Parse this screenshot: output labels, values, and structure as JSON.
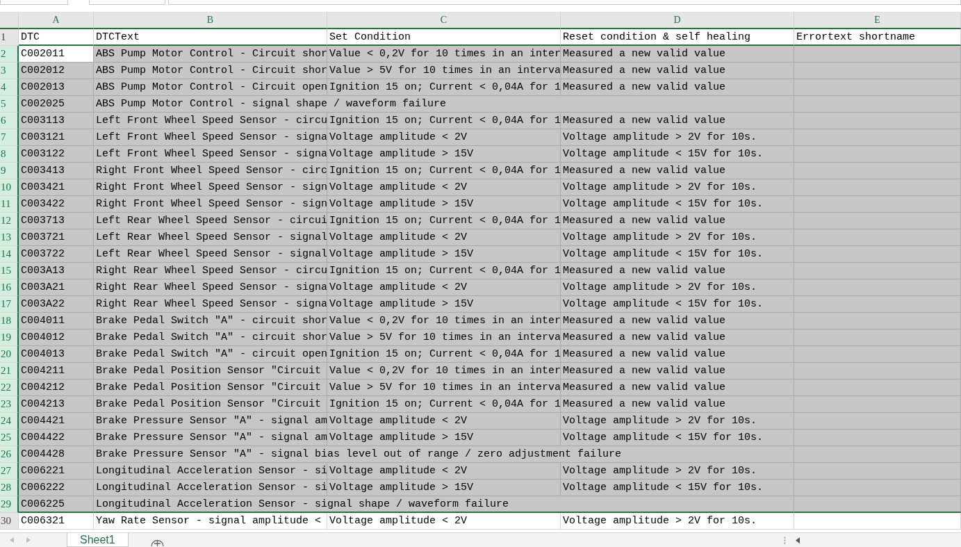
{
  "columns": [
    {
      "label": "A"
    },
    {
      "label": "B"
    },
    {
      "label": "C"
    },
    {
      "label": "D"
    },
    {
      "label": "E"
    }
  ],
  "rows": [
    {
      "number": "1",
      "selected": false,
      "cells": [
        "DTC",
        "DTCText",
        "Set Condition",
        "Reset condition & self healing",
        "Errortext shortname"
      ]
    },
    {
      "number": "2",
      "selected": true,
      "cells": [
        {
          "text": "C002011",
          "active": true
        },
        "ABS Pump Motor Control - Circuit shor",
        "Value < 0,2V for 10 times in an inter",
        "Measured a new valid value",
        null
      ]
    },
    {
      "number": "3",
      "selected": true,
      "cells": [
        "C002012",
        "ABS Pump Motor Control - Circuit shor",
        "Value > 5V for 10 times in an interva",
        "Measured a new valid value",
        null
      ]
    },
    {
      "number": "4",
      "selected": true,
      "cells": [
        "C002013",
        "ABS Pump Motor Control - Circuit open",
        "Ignition 15 on; Current < 0,04A for 1",
        "Measured a new valid value",
        null
      ]
    },
    {
      "number": "5",
      "selected": true,
      "cells": [
        "C002025",
        "ABS Pump Motor Control - signal shape / waveform failure",
        null,
        null,
        null
      ]
    },
    {
      "number": "6",
      "selected": true,
      "cells": [
        "C003113",
        "Left Front Wheel Speed Sensor - circu",
        "Ignition 15 on; Current < 0,04A for 1",
        "Measured a new valid value",
        null
      ]
    },
    {
      "number": "7",
      "selected": true,
      "cells": [
        "C003121",
        "Left Front Wheel Speed Sensor - signa",
        "Voltage amplitude < 2V",
        "Voltage amplitude > 2V for 10s.",
        null
      ]
    },
    {
      "number": "8",
      "selected": true,
      "cells": [
        "C003122",
        "Left Front Wheel Speed Sensor - signa",
        "Voltage amplitude > 15V",
        "Voltage amplitude < 15V for 10s.",
        null
      ]
    },
    {
      "number": "9",
      "selected": true,
      "cells": [
        "C003413",
        "Right Front Wheel Speed Sensor - circ",
        "Ignition 15 on; Current < 0,04A for 1",
        "Measured a new valid value",
        null
      ]
    },
    {
      "number": "10",
      "selected": true,
      "cells": [
        "C003421",
        "Right Front Wheel Speed Sensor - sign",
        "Voltage amplitude < 2V",
        "Voltage amplitude > 2V for 10s.",
        null
      ]
    },
    {
      "number": "11",
      "selected": true,
      "cells": [
        "C003422",
        "Right Front Wheel Speed Sensor - sign",
        "Voltage amplitude > 15V",
        "Voltage amplitude < 15V for 10s.",
        null
      ]
    },
    {
      "number": "12",
      "selected": true,
      "cells": [
        "C003713",
        "Left Rear Wheel Speed Sensor - circui",
        "Ignition 15 on; Current < 0,04A for 1",
        "Measured a new valid value",
        null
      ]
    },
    {
      "number": "13",
      "selected": true,
      "cells": [
        "C003721",
        "Left Rear Wheel Speed Sensor - signal",
        "Voltage amplitude < 2V",
        "Voltage amplitude > 2V for 10s.",
        null
      ]
    },
    {
      "number": "14",
      "selected": true,
      "cells": [
        "C003722",
        "Left Rear Wheel Speed Sensor - signal",
        "Voltage amplitude > 15V",
        "Voltage amplitude < 15V for 10s.",
        null
      ]
    },
    {
      "number": "15",
      "selected": true,
      "cells": [
        "C003A13",
        "Right Rear Wheel Speed Sensor - circu",
        "Ignition 15 on; Current < 0,04A for 1",
        "Measured a new valid value",
        null
      ]
    },
    {
      "number": "16",
      "selected": true,
      "cells": [
        "C003A21",
        "Right Rear Wheel Speed Sensor - signa",
        "Voltage amplitude < 2V",
        "Voltage amplitude > 2V for 10s.",
        null
      ]
    },
    {
      "number": "17",
      "selected": true,
      "cells": [
        "C003A22",
        "Right Rear Wheel Speed Sensor - signa",
        "Voltage amplitude > 15V",
        "Voltage amplitude < 15V for 10s.",
        null
      ]
    },
    {
      "number": "18",
      "selected": true,
      "cells": [
        "C004011",
        "Brake Pedal Switch \"A\" - circuit shor",
        "Value < 0,2V for 10 times in an inter",
        "Measured a new valid value",
        null
      ]
    },
    {
      "number": "19",
      "selected": true,
      "cells": [
        "C004012",
        "Brake Pedal Switch \"A\" - circuit shor",
        "Value > 5V for 10 times in an interva",
        "Measured a new valid value",
        null
      ]
    },
    {
      "number": "20",
      "selected": true,
      "cells": [
        "C004013",
        "Brake Pedal Switch \"A\" - circuit open",
        "Ignition 15 on; Current < 0,04A for 1",
        "Measured a new valid value",
        null
      ]
    },
    {
      "number": "21",
      "selected": true,
      "cells": [
        "C004211",
        "Brake Pedal Position Sensor \"Circuit",
        "Value < 0,2V for 10 times in an inter",
        "Measured a new valid value",
        null
      ]
    },
    {
      "number": "22",
      "selected": true,
      "cells": [
        "C004212",
        "Brake Pedal Position Sensor \"Circuit",
        "Value > 5V for 10 times in an interva",
        "Measured a new valid value",
        null
      ]
    },
    {
      "number": "23",
      "selected": true,
      "cells": [
        "C004213",
        "Brake Pedal Position Sensor \"Circuit",
        "Ignition 15 on; Current < 0,04A for 1",
        "Measured a new valid value",
        null
      ]
    },
    {
      "number": "24",
      "selected": true,
      "cells": [
        "C004421",
        "Brake Pressure Sensor \"A\" - signal am",
        "Voltage amplitude < 2V",
        "Voltage amplitude > 2V for 10s.",
        null
      ]
    },
    {
      "number": "25",
      "selected": true,
      "cells": [
        "C004422",
        "Brake Pressure Sensor \"A\" - signal am",
        "Voltage amplitude > 15V",
        "Voltage amplitude < 15V for 10s.",
        null
      ]
    },
    {
      "number": "26",
      "selected": true,
      "cells": [
        "C004428",
        "Brake Pressure Sensor \"A\" - signal bias level out of range / zero adjustment failure",
        null,
        null,
        null
      ]
    },
    {
      "number": "27",
      "selected": true,
      "cells": [
        "C006221",
        "Longitudinal Acceleration Sensor - si",
        "Voltage amplitude < 2V",
        "Voltage amplitude > 2V for 10s.",
        null
      ]
    },
    {
      "number": "28",
      "selected": true,
      "cells": [
        "C006222",
        "Longitudinal Acceleration Sensor - si",
        "Voltage amplitude > 15V",
        "Voltage amplitude < 15V for 10s.",
        null
      ]
    },
    {
      "number": "29",
      "selected": true,
      "cells": [
        "C006225",
        "Longitudinal Acceleration Sensor - signal shape / waveform failure",
        null,
        null,
        null
      ]
    },
    {
      "number": "30",
      "selected": false,
      "cells": [
        "C006321",
        "Yaw Rate Sensor - signal amplitude <",
        "Voltage amplitude < 2V",
        "Voltage amplitude > 2V for 10s.",
        null
      ]
    }
  ],
  "sheet_tabs": [
    {
      "label": "Sheet1",
      "selected": true
    }
  ]
}
